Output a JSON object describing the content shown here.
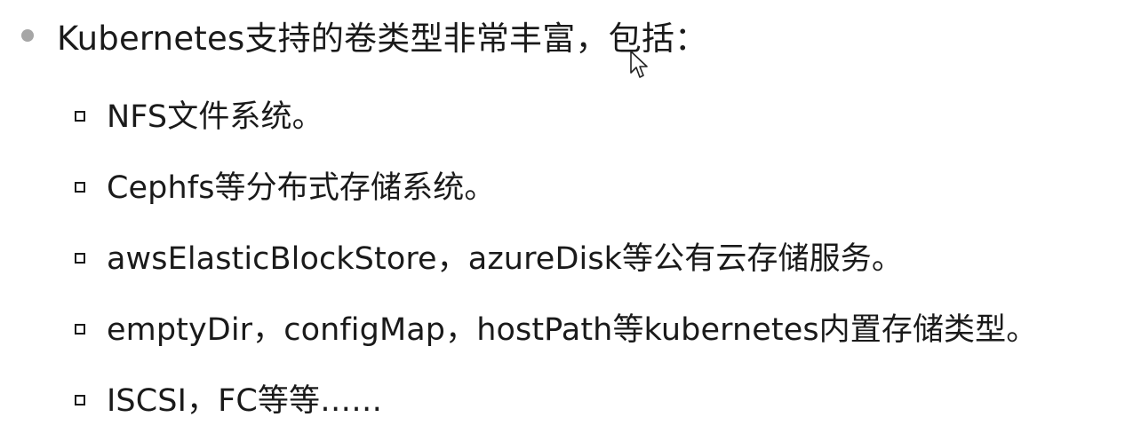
{
  "slide": {
    "heading": "Kubernetes支持的卷类型非常丰富，包括：",
    "items": [
      {
        "text": "NFS文件系统。"
      },
      {
        "text": "Cephfs等分布式存储系统。"
      },
      {
        "text": "awsElasticBlockStore，azureDisk等公有云存储服务。"
      },
      {
        "text": "emptyDir，configMap，hostPath等kubernetes内置存储类型。"
      },
      {
        "text": "ISCSI，FC等等……"
      }
    ]
  },
  "icons": {
    "level1_bullet": "circle-bullet-icon",
    "level2_bullet": "square-bullet-icon",
    "pointer": "mouse-pointer-icon"
  },
  "colors": {
    "background": "#ffffff",
    "text": "#1a1a1a",
    "bullet_dot": "#a6a6a6"
  }
}
